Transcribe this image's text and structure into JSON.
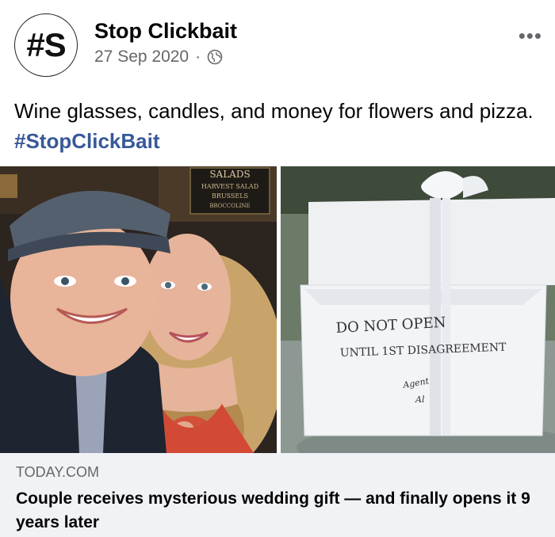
{
  "post": {
    "avatar_text": "#S",
    "page_name": "Stop Clickbait",
    "date": "27 Sep 2020",
    "separator": "·",
    "audience_icon": "globe-icon",
    "more_icon": "more-options-icon",
    "more_label": "•••",
    "caption_text": "Wine glasses, candles, and money for flowers and pizza. ",
    "caption_hashtag": "#StopClickBait"
  },
  "photos": {
    "left_sign_lines": [
      "SALADS",
      "HARVEST SALAD",
      "BRUSSELS",
      "BROCCOLINE"
    ],
    "gift_note": [
      "DO NOT OPEN",
      "UNTIL 1ST DISAGREEMENT",
      "Agent",
      "Al"
    ]
  },
  "link_preview": {
    "domain": "TODAY.COM",
    "title": "Couple receives mysterious wedding gift — and finally opens it 9 years later"
  },
  "colors": {
    "hashtag": "#385898",
    "card_bg": "#f0f2f5",
    "meta": "#65676b"
  }
}
